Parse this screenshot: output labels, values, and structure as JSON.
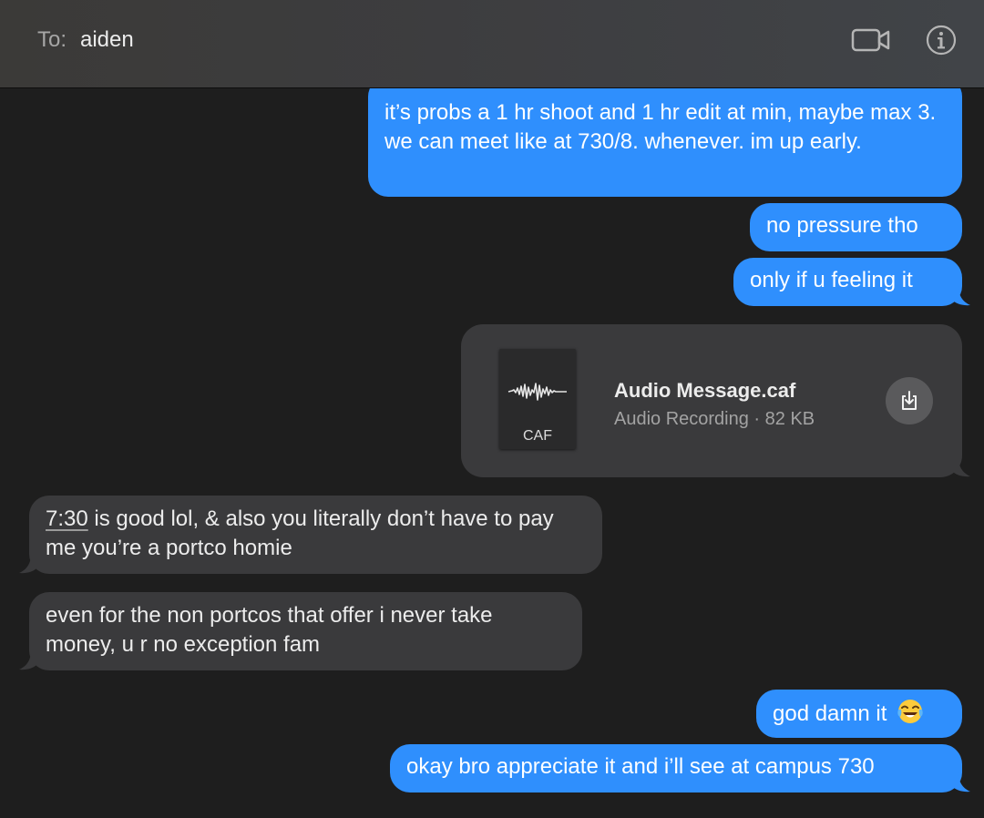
{
  "header": {
    "to_label": "To:",
    "recipient": "aiden",
    "video_icon": "video-camera-icon",
    "info_icon": "info-icon"
  },
  "messages": [
    {
      "direction": "outgoing",
      "text": "it’s probs a 1 hr shoot and 1 hr edit at min, maybe max 3. we can meet like at 730/8. whenever. im up early."
    },
    {
      "direction": "outgoing",
      "text": "no pressure tho"
    },
    {
      "direction": "outgoing",
      "text": "only if u feeling it"
    },
    {
      "direction": "outgoing",
      "type": "attachment"
    },
    {
      "direction": "incoming",
      "link_text": "7:30",
      "text": " is good lol, & also you literally don’t have to pay me you’re a portco homie"
    },
    {
      "direction": "incoming",
      "text": "even for the non portcos that offer i never take money, u r no exception fam"
    },
    {
      "direction": "outgoing",
      "text": "god damn it",
      "emoji": "tears-of-joy"
    },
    {
      "direction": "outgoing",
      "text": "okay bro appreciate it and i’ll see at campus 730"
    }
  ],
  "attachment": {
    "file_name": "Audio Message.caf",
    "file_type_badge": "CAF",
    "meta": "Audio Recording · 82 KB",
    "download_icon": "download-icon"
  },
  "colors": {
    "outgoing_bubble": "#2f8ffd",
    "incoming_bubble": "#3a3a3c",
    "background": "#1e1e1e"
  }
}
